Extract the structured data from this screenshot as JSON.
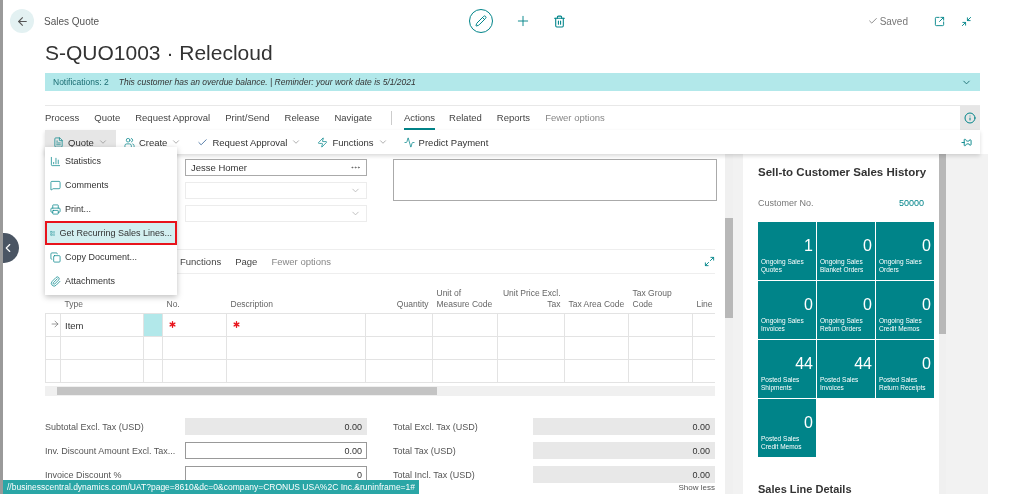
{
  "header": {
    "breadcrumb": "Sales Quote",
    "title": "S-QUO1003 · Relecloud",
    "status": "Saved"
  },
  "notification": {
    "count_label": "Notifications: 2",
    "message": "This customer has an overdue balance. | Reminder: your work date is 5/1/2021"
  },
  "action_tabs": {
    "promoted": [
      {
        "label": "Process",
        "selected": false
      },
      {
        "label": "Quote",
        "selected": false
      },
      {
        "label": "Request Approval",
        "selected": false
      },
      {
        "label": "Print/Send",
        "selected": false
      },
      {
        "label": "Release",
        "selected": false
      },
      {
        "label": "Navigate",
        "selected": false
      }
    ],
    "more": [
      {
        "label": "Actions",
        "selected": true
      },
      {
        "label": "Related",
        "selected": false
      },
      {
        "label": "Reports",
        "selected": false
      }
    ],
    "toggle": "Fewer options"
  },
  "action_bar": [
    {
      "label": "Quote",
      "selected": true,
      "caret": true
    },
    {
      "label": "Create",
      "selected": false,
      "caret": true
    },
    {
      "label": "Request Approval",
      "selected": false,
      "caret": true
    },
    {
      "label": "Functions",
      "selected": false,
      "caret": true
    },
    {
      "label": "Predict Payment",
      "selected": false,
      "caret": false
    }
  ],
  "menu": [
    {
      "label": "Statistics",
      "selected": false
    },
    {
      "label": "Comments",
      "selected": false
    },
    {
      "label": "Print...",
      "selected": false
    },
    {
      "label": "Get Recurring Sales Lines...",
      "selected": true
    },
    {
      "label": "Copy Document...",
      "selected": false
    },
    {
      "label": "Attachments",
      "selected": false
    }
  ],
  "fields": [
    {
      "kind": "lookup",
      "value": "Jesse Homer"
    },
    {
      "kind": "dropdown"
    },
    {
      "kind": "dropdown"
    }
  ],
  "lines": {
    "tabs": [
      {
        "label": "Functions"
      },
      {
        "label": "Page"
      }
    ],
    "toggle": "Fewer options",
    "columns": [
      {
        "label": "Type",
        "numeric": false
      },
      {
        "label": "No.",
        "numeric": false
      },
      {
        "label": "Description",
        "numeric": false
      },
      {
        "label": "Quantity",
        "numeric": true
      },
      {
        "label": "Unit of Measure Code",
        "numeric": false
      },
      {
        "label": "Unit Price Excl. Tax",
        "numeric": true
      },
      {
        "label": "Tax Area Code",
        "numeric": false
      },
      {
        "label": "Tax Group Code",
        "numeric": false
      },
      {
        "label": "Line",
        "numeric": false
      }
    ],
    "rows": [
      {
        "current": true,
        "type": "Item",
        "missing_required": true
      },
      {
        "current": false,
        "missing_required": false
      },
      {
        "current": false,
        "missing_required": false
      }
    ]
  },
  "totals": {
    "left": [
      {
        "label": "Subtotal Excl. Tax (USD)",
        "value": "0.00",
        "editable": false
      },
      {
        "label": "Inv. Discount Amount Excl. Tax...",
        "value": "0.00",
        "editable": true
      },
      {
        "label": "Invoice Discount %",
        "value": "0",
        "editable": true
      }
    ],
    "right": [
      {
        "label": "Total Excl. Tax (USD)",
        "value": "0.00",
        "editable": false
      },
      {
        "label": "Total Tax (USD)",
        "value": "0.00",
        "editable": false
      },
      {
        "label": "Total Incl. Tax (USD)",
        "value": "0.00",
        "editable": false
      }
    ]
  },
  "show_less": "Show less",
  "factbox": {
    "title": "Sell-to Customer Sales History",
    "customer_label": "Customer No.",
    "customer_no": "50000",
    "tiles": [
      {
        "value": "1",
        "label": "Ongoing Sales Quotes"
      },
      {
        "value": "0",
        "label": "Ongoing Sales Blanket Orders"
      },
      {
        "value": "0",
        "label": "Ongoing Sales Orders"
      },
      {
        "value": "0",
        "label": "Ongoing Sales Invoices"
      },
      {
        "value": "0",
        "label": "Ongoing Sales Return Orders"
      },
      {
        "value": "0",
        "label": "Ongoing Sales Credit Memos"
      },
      {
        "value": "44",
        "label": "Posted Sales Shipments"
      },
      {
        "value": "44",
        "label": "Posted Sales Invoices"
      },
      {
        "value": "0",
        "label": "Posted Sales Return Receipts"
      },
      {
        "value": "0",
        "label": "Posted Sales Credit Memos"
      }
    ],
    "next_section": "Sales Line Details"
  },
  "status_url": "//businesscentral.dynamics.com/UAT?page=8610&dc=0&company=CRONUS USA%2C Inc.&runinframe=1#"
}
